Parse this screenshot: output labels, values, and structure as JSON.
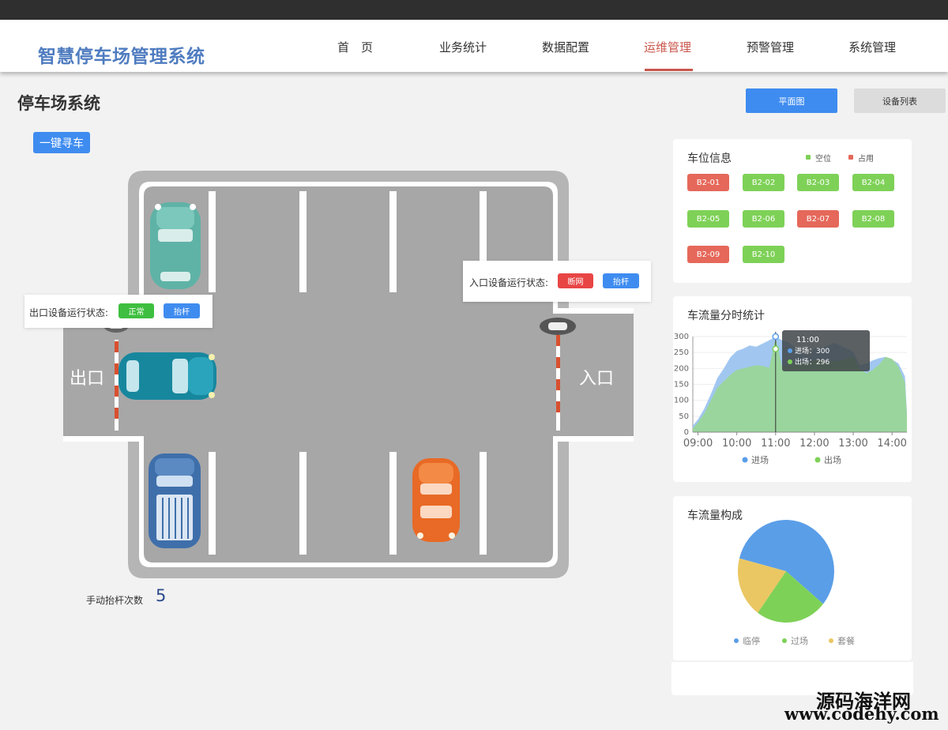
{
  "app": {
    "title": "智慧停车场管理系统"
  },
  "nav": {
    "items": [
      {
        "label": "首　页",
        "active": false
      },
      {
        "label": "业务统计",
        "active": false
      },
      {
        "label": "数据配置",
        "active": false
      },
      {
        "label": "运维管理",
        "active": true
      },
      {
        "label": "预警管理",
        "active": false
      },
      {
        "label": "系统管理",
        "active": false
      }
    ]
  },
  "page": {
    "title": "停车场系统",
    "plan_button": "平面图",
    "device_list_button": "设备列表",
    "find_car_button": "一键寻车"
  },
  "lot": {
    "exit_label": "出口",
    "entry_label": "入口",
    "exit_device": {
      "status_label": "出口设备运行状态:",
      "status": "正常",
      "status_color": "#3fbf3f",
      "action": "抬杆"
    },
    "entry_device": {
      "status_label": "入口设备运行状态:",
      "status": "断网",
      "status_color": "#e84545",
      "action": "抬杆"
    },
    "manual_lift_label": "手动抬杆次数",
    "manual_lift_count": "5"
  },
  "spaces": {
    "title": "车位信息",
    "legend_free": "空位",
    "legend_occupied": "占用",
    "free_color": "#7ed157",
    "occupied_color": "#e5685a",
    "items": [
      {
        "id": "B2-01",
        "status": "occupied"
      },
      {
        "id": "B2-02",
        "status": "free"
      },
      {
        "id": "B2-03",
        "status": "free"
      },
      {
        "id": "B2-04",
        "status": "free"
      },
      {
        "id": "B2-05",
        "status": "free"
      },
      {
        "id": "B2-06",
        "status": "free"
      },
      {
        "id": "B2-07",
        "status": "occupied"
      },
      {
        "id": "B2-08",
        "status": "free"
      },
      {
        "id": "B2-09",
        "status": "occupied"
      },
      {
        "id": "B2-10",
        "status": "free"
      }
    ]
  },
  "hourly": {
    "title": "车流量分时统计",
    "tooltip": {
      "time": "11:00",
      "in_label": "进场",
      "in_value": "300",
      "out_label": "出场",
      "out_value": "296"
    }
  },
  "composition": {
    "title": "车流量构成"
  },
  "chart_data": [
    {
      "type": "area",
      "title": "车流量分时统计",
      "ylim": [
        0,
        300
      ],
      "yticks": [
        0,
        50,
        100,
        150,
        200,
        250,
        300
      ],
      "xticks": [
        "09:00",
        "10:00",
        "11:00",
        "12:00",
        "13:00",
        "14:00"
      ],
      "xrange": [
        "08:52",
        "14:23"
      ],
      "grid": true,
      "legend_position": "bottom",
      "x": [
        "08:52",
        "09:00",
        "09:10",
        "09:20",
        "09:30",
        "09:40",
        "09:50",
        "10:00",
        "10:10",
        "10:20",
        "10:30",
        "10:40",
        "10:50",
        "11:00",
        "11:10",
        "11:20",
        "11:30",
        "11:40",
        "11:50",
        "12:00",
        "12:10",
        "12:20",
        "12:30",
        "12:40",
        "12:50",
        "13:00",
        "13:10",
        "13:20",
        "13:30",
        "13:40",
        "13:50",
        "14:00",
        "14:10",
        "14:20",
        "14:23"
      ],
      "series": [
        {
          "name": "进场",
          "color": "#9cc4f0",
          "values": [
            20,
            40,
            75,
            120,
            170,
            200,
            235,
            255,
            262,
            272,
            268,
            278,
            288,
            300,
            288,
            282,
            265,
            250,
            242,
            262,
            266,
            270,
            280,
            272,
            262,
            252,
            210,
            215,
            225,
            232,
            236,
            228,
            215,
            175,
            60
          ]
        },
        {
          "name": "出场",
          "color": "#9ad698",
          "values": [
            12,
            30,
            60,
            100,
            140,
            160,
            180,
            195,
            200,
            205,
            210,
            208,
            202,
            296,
            205,
            210,
            215,
            218,
            220,
            226,
            226,
            224,
            222,
            225,
            230,
            238,
            200,
            185,
            195,
            212,
            236,
            230,
            205,
            155,
            50
          ]
        }
      ],
      "tooltip_at": "11:00"
    },
    {
      "type": "pie",
      "title": "车流量构成",
      "legend_position": "bottom",
      "labels": [
        "临停",
        "过场",
        "套餐"
      ],
      "values": [
        57,
        24,
        19
      ],
      "colors": [
        "#5a9ee8",
        "#7ed157",
        "#eac763"
      ]
    }
  ]
}
